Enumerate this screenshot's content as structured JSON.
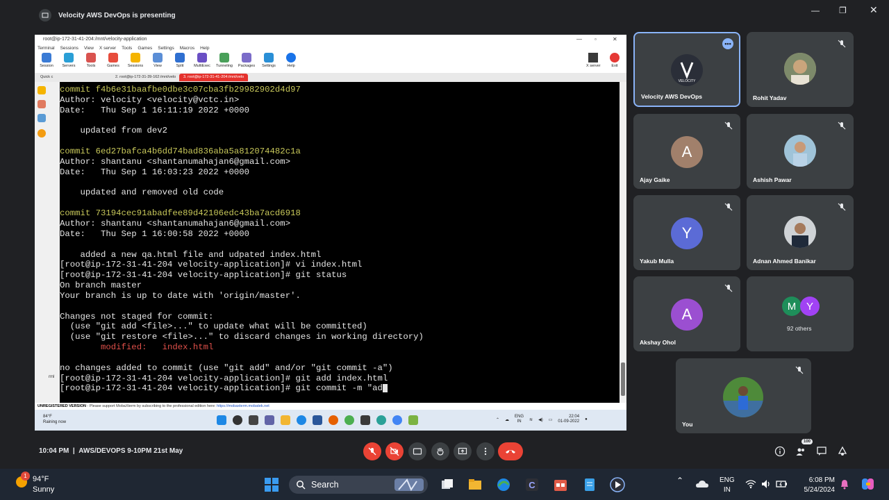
{
  "top": {
    "presenting": "Velocity AWS DevOps is presenting"
  },
  "mobaxterm": {
    "title": "root@ip-172-31-41-204:/mnt/velocity-application",
    "menu": [
      "Terminal",
      "Sessions",
      "View",
      "X server",
      "Tools",
      "Games",
      "Settings",
      "Macros",
      "Help"
    ],
    "tools": [
      "Session",
      "Servers",
      "Tools",
      "Games",
      "Sessions",
      "View",
      "Split",
      "MultiExec",
      "Tunneling",
      "Packages",
      "Settings",
      "Help"
    ],
    "tools_right": [
      "X server",
      "Exit"
    ],
    "quick": "Quick c",
    "tab_inactive": "2. root@ip-172-31-39-162:/mnt/velo",
    "tab_active": "3. root@ip-172-31-41-204:/mnt/velo",
    "status_left": "UNREGISTERED VERSION",
    "status_msg": " -  Please support MobaXterm by subscribing to the professional edition here: ",
    "status_link": "https://mobaxterm.mobatek.net",
    "side_label": "rml"
  },
  "terminal": {
    "lines": [
      {
        "t": "commit f4b6e31baafbe0dbe3c07cba3fb29982902d4d97",
        "c": "y"
      },
      {
        "t": "Author: velocity <velocity@vctc.in>"
      },
      {
        "t": "Date:   Thu Sep 1 16:11:19 2022 +0000"
      },
      {
        "t": ""
      },
      {
        "t": "    updated from dev2"
      },
      {
        "t": ""
      },
      {
        "t": "commit 6ed27bafca4b6dd74bad836aba5a812074482c1a",
        "c": "y"
      },
      {
        "t": "Author: shantanu <shantanumahajan6@gmail.com>"
      },
      {
        "t": "Date:   Thu Sep 1 16:03:23 2022 +0000"
      },
      {
        "t": ""
      },
      {
        "t": "    updated and removed old code"
      },
      {
        "t": ""
      },
      {
        "t": "commit 73194cec91abadfee89d42106edc43ba7acd6918",
        "c": "y"
      },
      {
        "t": "Author: shantanu <shantanumahajan6@gmail.com>"
      },
      {
        "t": "Date:   Thu Sep 1 16:00:58 2022 +0000"
      },
      {
        "t": ""
      },
      {
        "t": "    added a new qa.html file and udpated index.html"
      },
      {
        "t": "[root@ip-172-31-41-204 velocity-application]# vi index.html"
      },
      {
        "t": "[root@ip-172-31-41-204 velocity-application]# git status"
      },
      {
        "t": "On branch master"
      },
      {
        "t": "Your branch is up to date with 'origin/master'."
      },
      {
        "t": ""
      },
      {
        "t": "Changes not staged for commit:"
      },
      {
        "t": "  (use \"git add <file>...\" to update what will be committed)"
      },
      {
        "t": "  (use \"git restore <file>...\" to discard changes in working directory)"
      },
      {
        "t": "        modified:   index.html",
        "c": "r"
      },
      {
        "t": ""
      },
      {
        "t": "no changes added to commit (use \"git add\" and/or \"git commit -a\")"
      },
      {
        "t": "[root@ip-172-31-41-204 velocity-application]# git add index.html"
      },
      {
        "t": "[root@ip-172-31-41-204 velocity-application]# git commit -m \"ad",
        "cursor": true
      }
    ]
  },
  "inner_taskbar": {
    "weather_temp": "84°F",
    "weather_desc": "Raining now",
    "lang": "ENG",
    "lang2": "IN",
    "time": "22:04",
    "date": "01-09-2022"
  },
  "participants": [
    {
      "name": "Velocity AWS DevOps",
      "kind": "logo"
    },
    {
      "name": "Rohit Yadav",
      "kind": "photo"
    },
    {
      "name": "Ajay Gaike",
      "kind": "letter",
      "letter": "A",
      "color": "#a1806b"
    },
    {
      "name": "Ashish Pawar",
      "kind": "photo"
    },
    {
      "name": "Yakub Mulla",
      "kind": "letter",
      "letter": "Y",
      "color": "#5b6bd6"
    },
    {
      "name": "Adnan Ahmed Banikar",
      "kind": "photo"
    },
    {
      "name": "Akshay Ohol",
      "kind": "letter",
      "letter": "A",
      "color": "#9b4fd1"
    },
    {
      "name": "You",
      "kind": "photo"
    }
  ],
  "others": {
    "label": "92 others",
    "a1": "M",
    "a2": "Y",
    "c1": "#1e8e5a",
    "c2": "#a142f4"
  },
  "logo_text": "VELOCITY",
  "meeting": {
    "time": "10:04 PM",
    "title": "AWS/DEVOPS 9-10PM 21st May",
    "people_badge": "100"
  },
  "windows": {
    "temp": "94°F",
    "weather": "Sunny",
    "weather_badge": "1",
    "search": "Search",
    "lang": "ENG",
    "lang2": "IN",
    "time": "6:08 PM",
    "date": "5/24/2024"
  }
}
